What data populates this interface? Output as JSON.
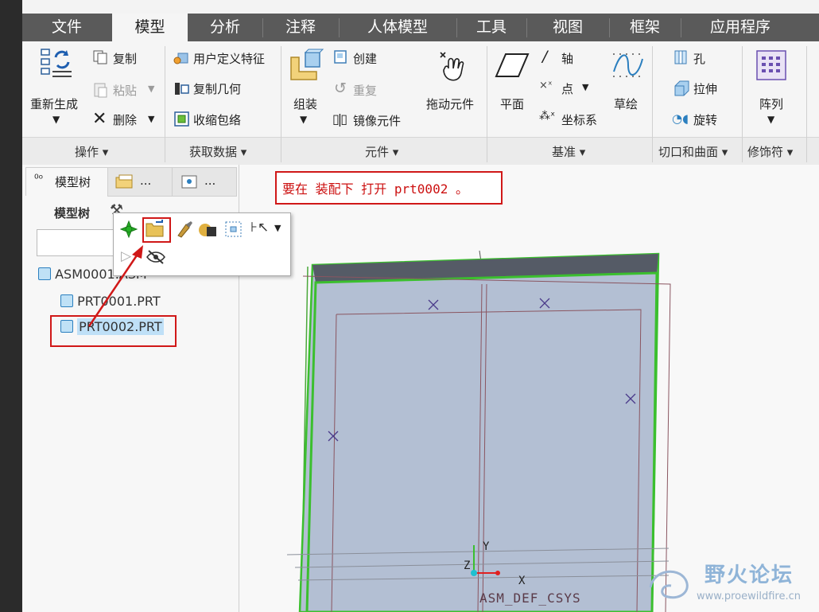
{
  "menu": {
    "tabs": [
      {
        "label": "文件"
      },
      {
        "label": "模型"
      },
      {
        "label": "分析"
      },
      {
        "label": "注释"
      },
      {
        "label": "人体模型"
      },
      {
        "label": "工具"
      },
      {
        "label": "视图"
      },
      {
        "label": "框架"
      },
      {
        "label": "应用程序"
      }
    ],
    "active": "模型"
  },
  "ribbon": {
    "operations": {
      "regenerate": "重新生成",
      "copy": "复制",
      "paste": "粘贴",
      "delete": "删除",
      "group": "操作"
    },
    "get_data": {
      "udf": "用户定义特征",
      "copy_geom": "复制几何",
      "shrinkwrap": "收缩包络",
      "group": "获取数据"
    },
    "component": {
      "assemble": "组装",
      "create": "创建",
      "repeat": "重复",
      "mirror": "镜像元件",
      "drag": "拖动元件",
      "group": "元件"
    },
    "datum": {
      "plane": "平面",
      "axis": "轴",
      "point": "点",
      "csys": "坐标系",
      "sketch": "草绘",
      "group": "基准"
    },
    "cut_surface": {
      "hole": "孔",
      "extrude": "拉伸",
      "revolve": "旋转",
      "group": "切口和曲面"
    },
    "modifier": {
      "pattern": "阵列",
      "group": "修饰符"
    }
  },
  "left_panel": {
    "tabs": {
      "model_tree": "模型树",
      "tab2": "...",
      "tab3": "..."
    },
    "header": "模型树",
    "tree": [
      "ASM0001.ASM",
      "PRT0001.PRT",
      "PRT0002.PRT"
    ],
    "selected": "PRT0002.PRT"
  },
  "annotation": {
    "text": "要在 装配下 打开 prt0002 。"
  },
  "viewport": {
    "axis_y": "Y",
    "axis_x": "X",
    "axis_z": "Z",
    "csys_label": "ASM_DEF_CSYS"
  },
  "watermark": {
    "title": "野火论坛",
    "url": "www.proewildfire.cn"
  },
  "colors": {
    "menubar": "#5a5a5a",
    "accent_red": "#d01818",
    "model_edge": "#3bbf2e",
    "model_fill": "#b3bfd3"
  }
}
